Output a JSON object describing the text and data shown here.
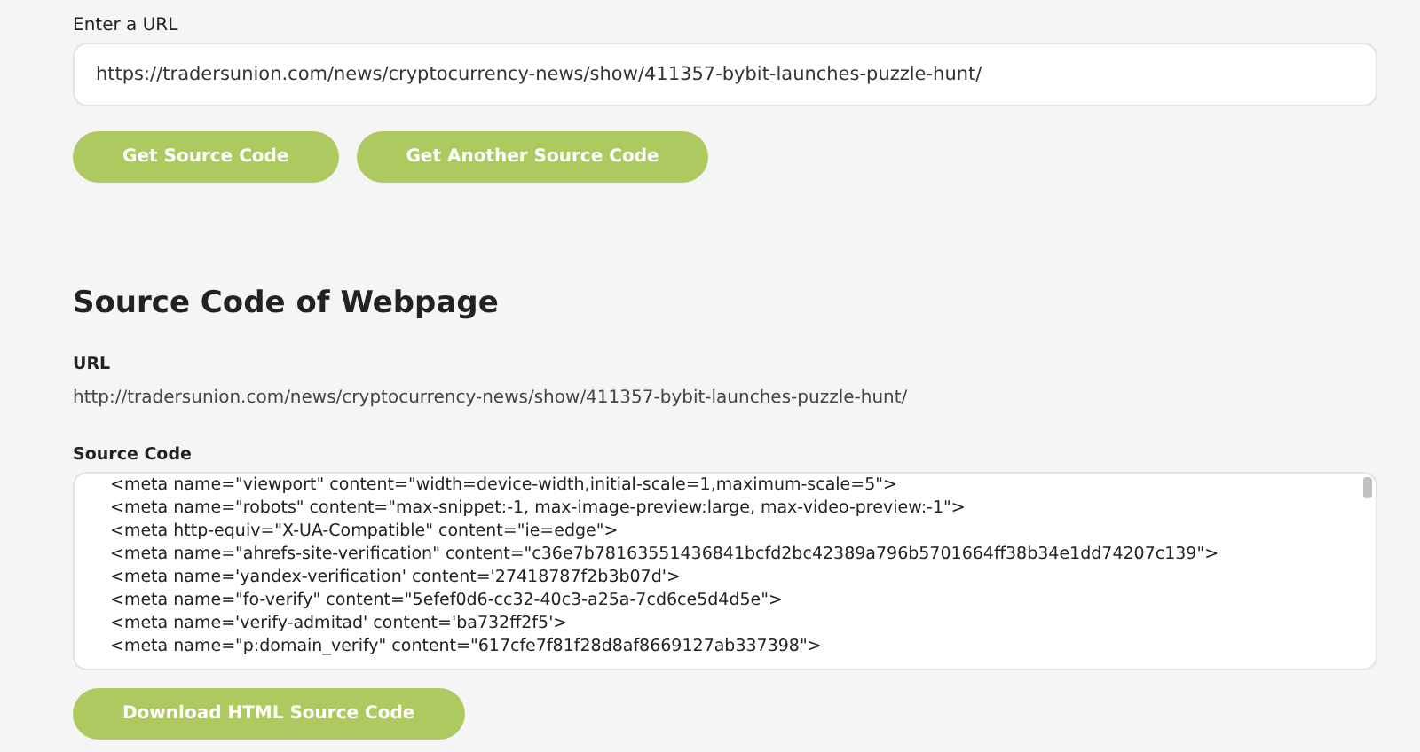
{
  "url_form": {
    "label": "Enter a URL",
    "value": "https://tradersunion.com/news/cryptocurrency-news/show/411357-bybit-launches-puzzle-hunt/",
    "buttons": [
      "Get Source Code",
      "Get Another Source Code"
    ]
  },
  "result": {
    "title": "Source Code of Webpage",
    "url_label": "URL",
    "url": "http://tradersunion.com/news/cryptocurrency-news/show/411357-bybit-launches-puzzle-hunt/",
    "source_label": "Source Code",
    "source_lines": [
      "<meta name=\"viewport\" content=\"width=device-width,initial-scale=1,maximum-scale=5\">",
      "<meta name=\"robots\" content=\"max-snippet:-1, max-image-preview:large, max-video-preview:-1\">",
      "<meta http-equiv=\"X-UA-Compatible\" content=\"ie=edge\">",
      "<meta name=\"ahrefs-site-verification\" content=\"c36e7b78163551436841bcfd2bc42389a796b5701664ff38b34e1dd74207c139\">",
      "<meta name='yandex-verification' content='27418787f2b3b07d'>",
      "<meta name=\"fo-verify\" content=\"5efef0d6-cc32-40c3-a25a-7cd6ce5d4d5e\">",
      "<meta name='verify-admitad' content='ba732ff2f5'>",
      "<meta name=\"p:domain_verify\" content=\"617cfe7f81f28d8af8669127ab337398\">"
    ],
    "download_button": "Download HTML Source Code"
  }
}
